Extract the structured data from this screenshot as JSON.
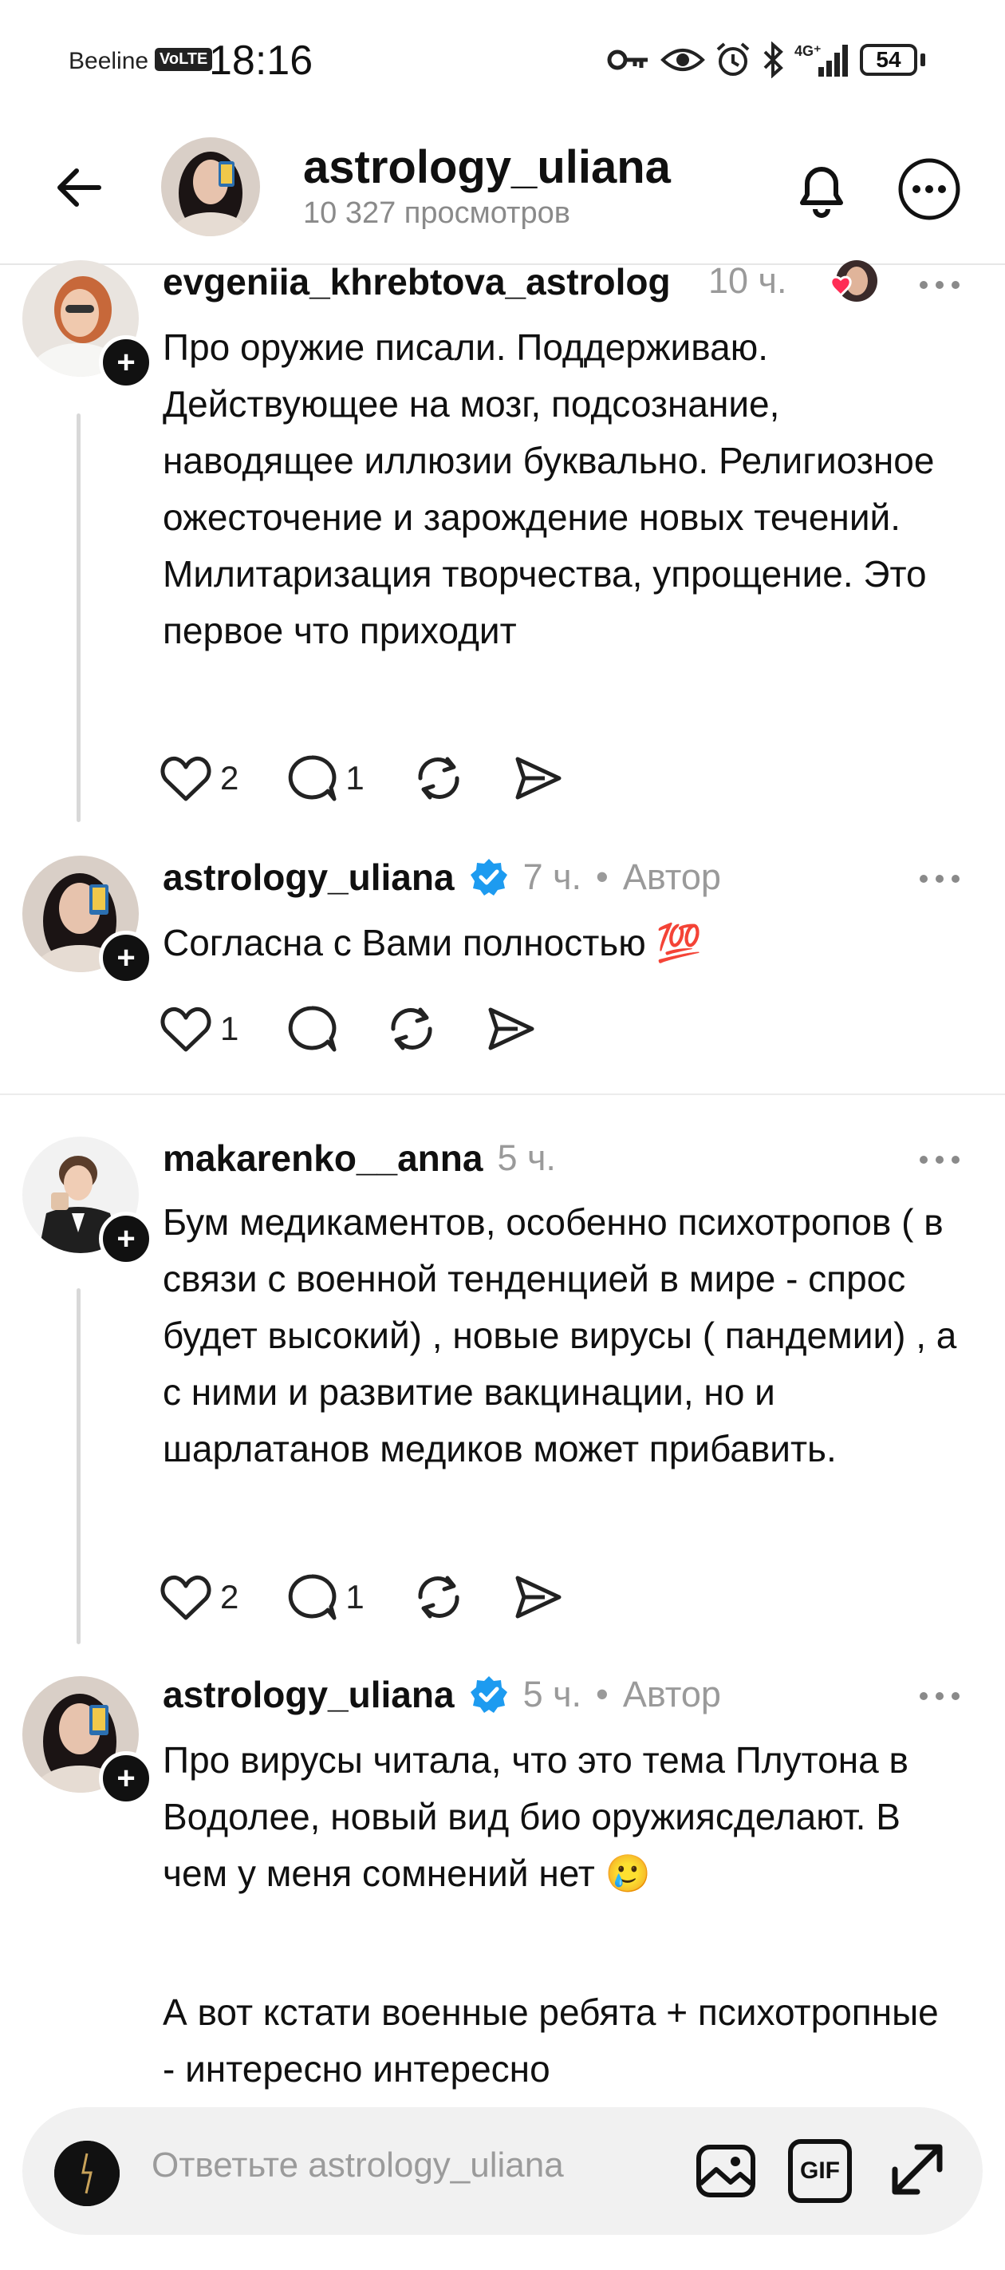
{
  "status": {
    "carrier": "Beeline",
    "volte": "VoLTE",
    "time": "18:16",
    "battery": "54",
    "icons": [
      "key-icon",
      "eye-icon",
      "alarm-icon",
      "bluetooth-icon",
      "signal-4g-icon",
      "battery-icon"
    ]
  },
  "header": {
    "title": "astrology_uliana",
    "subtitle": "10 327 просмотров"
  },
  "comments": [
    {
      "username": "evgeniia_khrebtova_astrolog",
      "time": "10 ч.",
      "author_tag": "",
      "verified": false,
      "liked_by_author": true,
      "text": "Про оружие писали. Поддерживаю. Действующее на мозг, подсознание, наводящее иллюзии буквально. Религиозное ожесточение и зарождение новых течений. Милитаризация творчества, упрощение. Это первое что приходит",
      "likes": "2",
      "replies": "1"
    },
    {
      "username": "astrology_uliana",
      "time": "7 ч.",
      "bullet": "•",
      "author_tag": "Автор",
      "verified": true,
      "text": "Согласна с Вами полностью 💯",
      "likes": "1",
      "replies": ""
    },
    {
      "username": "makarenko__anna",
      "time": "5 ч.",
      "author_tag": "",
      "verified": false,
      "text": "Бум медикаментов, особенно психотропов ( в связи с военной тенденцией в мире -  спрос будет высокий) , новые вирусы ( пандемии) , а с ними и развитие вакцинации, но и шарлатанов медиков может прибавить.",
      "likes": "2",
      "replies": "1"
    },
    {
      "username": "astrology_uliana",
      "time": "5 ч.",
      "bullet": "•",
      "author_tag": "Автор",
      "verified": true,
      "text": "Про вирусы читала, что это тема Плутона в Водолее, новый вид био оружиясделают.  В чем у меня сомнений нет 🥲",
      "text2": "А вот кстати военные ребята + психотропные - интересно интересно"
    }
  ],
  "composer": {
    "placeholder": "Ответьте astrology_uliana",
    "gif_label": "GIF"
  },
  "colors": {
    "verified": "#1d9bf0",
    "heart_badge": "#ff2d55",
    "muted": "#9a9a9a"
  }
}
